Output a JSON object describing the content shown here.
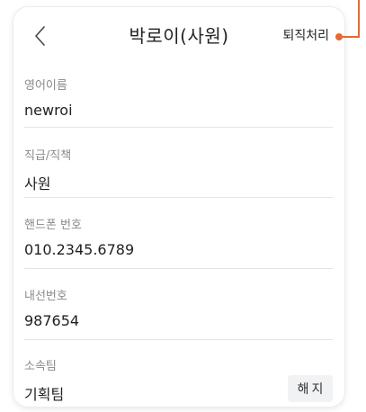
{
  "header": {
    "title": "박로이(사원)",
    "resign_label": "퇴직처리"
  },
  "fields": [
    {
      "label": "영어이름",
      "value": "newroi"
    },
    {
      "label": "직급/직책",
      "value": "사원"
    },
    {
      "label": "핸드폰 번호",
      "value": "010.2345.6789"
    },
    {
      "label": "내선번호",
      "value": "987654"
    },
    {
      "label": "소속팀",
      "value": "기획팀"
    }
  ],
  "team_release_label": "해지",
  "colors": {
    "accent": "#e8682d",
    "label": "#8a8a8a",
    "value": "#1f1f1f",
    "divider": "#e5e5e5",
    "button_bg": "#f1f2f4"
  },
  "icons": {
    "back": "chevron-left-icon"
  }
}
